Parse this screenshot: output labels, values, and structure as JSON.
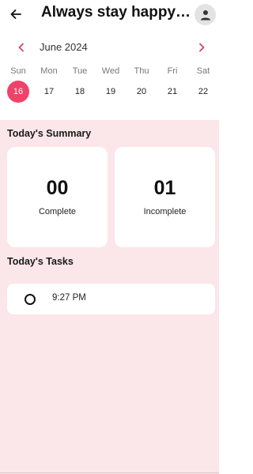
{
  "header": {
    "title": "Always stay happy…",
    "back_icon": "arrow-left-icon",
    "profile_icon": "person-icon"
  },
  "calendar": {
    "month_label": "June 2024",
    "days": [
      {
        "name": "Sun",
        "num": "16",
        "selected": true
      },
      {
        "name": "Mon",
        "num": "17",
        "selected": false
      },
      {
        "name": "Tue",
        "num": "18",
        "selected": false
      },
      {
        "name": "Wed",
        "num": "19",
        "selected": false
      },
      {
        "name": "Thu",
        "num": "20",
        "selected": false
      },
      {
        "name": "Fri",
        "num": "21",
        "selected": false
      },
      {
        "name": "Sat",
        "num": "22",
        "selected": false
      }
    ]
  },
  "summary": {
    "title": "Today's Summary",
    "complete_count": "00",
    "complete_label": "Complete",
    "incomplete_count": "01",
    "incomplete_label": "Incomplete"
  },
  "tasks": {
    "title": "Today's Tasks",
    "items": [
      {
        "time": "9:27 PM",
        "done": false
      }
    ]
  },
  "colors": {
    "accent": "#f0436a",
    "background": "#fbe6ea",
    "card": "#ffffff"
  }
}
